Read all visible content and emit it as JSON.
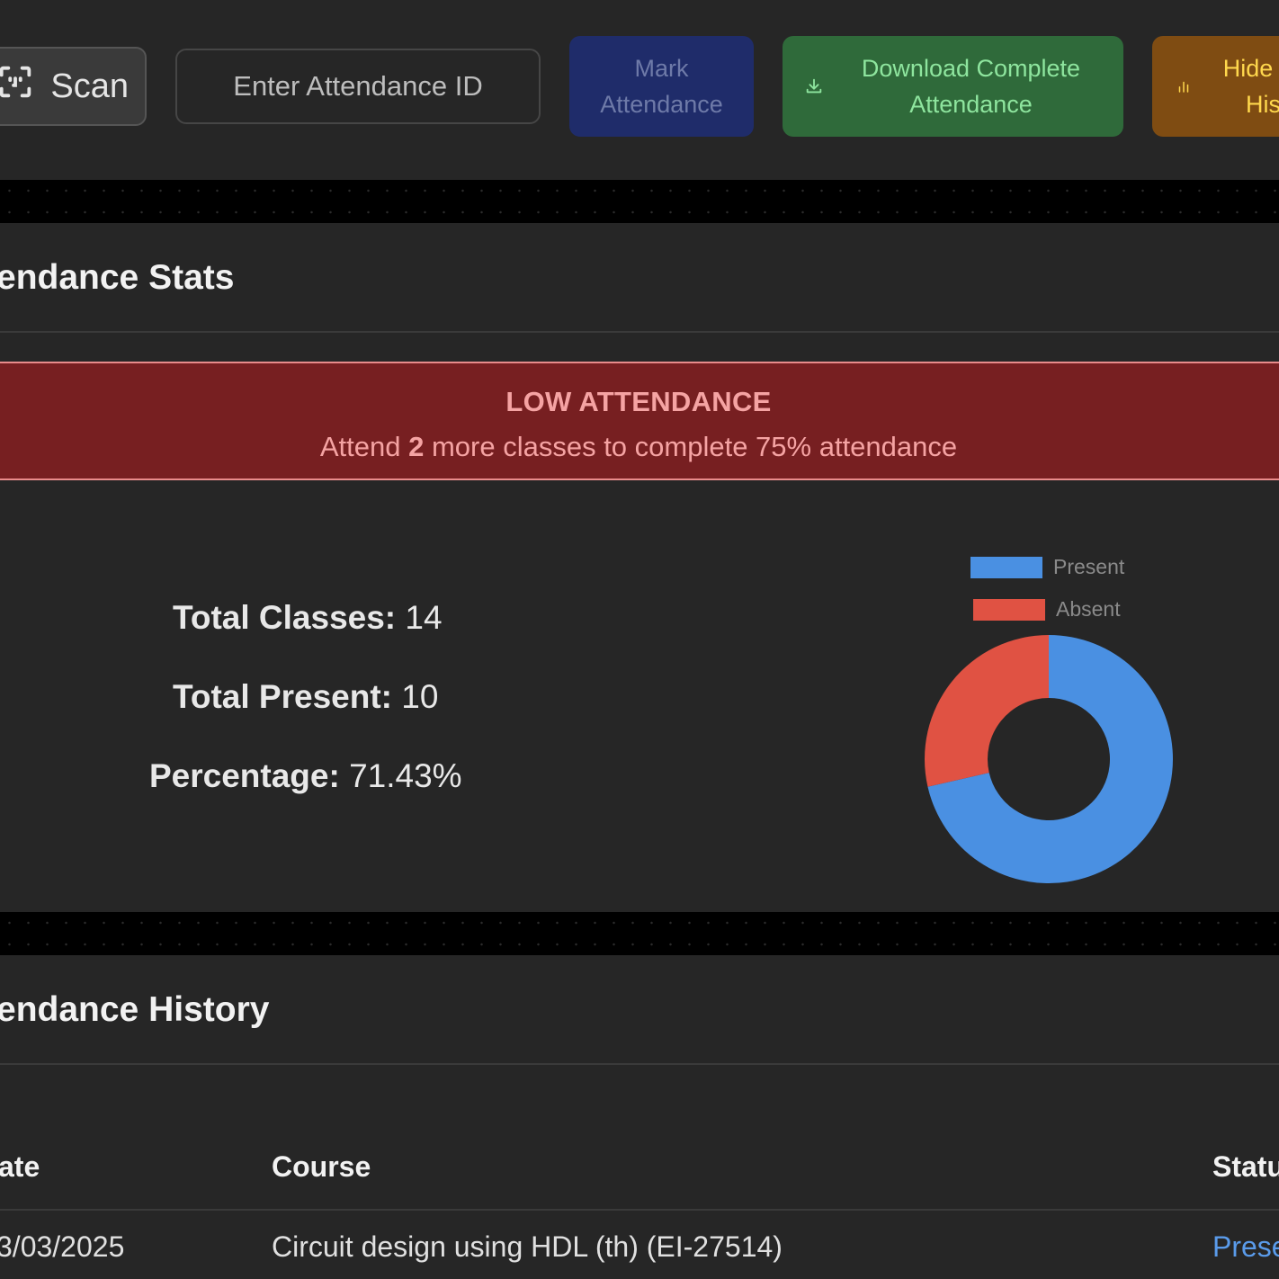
{
  "toolbar": {
    "scan_label": "Scan",
    "attendance_id_placeholder": "Enter Attendance ID",
    "mark_label_line1": "Mark",
    "mark_label_line2": "Attendance",
    "download_label_line1": "Download Complete",
    "download_label_line2": "Attendance",
    "hide_label_line1": "Hide",
    "hide_label_line2": "His"
  },
  "stats": {
    "title": "endance Stats",
    "alert": {
      "title": "LOW ATTENDANCE",
      "msg_before": "Attend ",
      "msg_count": "2",
      "msg_after": " more classes to complete 75% attendance"
    },
    "total_classes_label": "Total Classes:",
    "total_classes_value": "14",
    "total_present_label": "Total Present:",
    "total_present_value": "10",
    "percentage_label": "Percentage:",
    "percentage_value": "71.43%"
  },
  "chart_data": {
    "type": "pie",
    "subtype": "doughnut",
    "legend_position": "top",
    "categories": [
      "Present",
      "Absent"
    ],
    "values": [
      10,
      4
    ],
    "colors": [
      "#4a90e2",
      "#e05243"
    ]
  },
  "history": {
    "title": "endance History",
    "columns": [
      "ate",
      "Course",
      "Statu"
    ],
    "rows": [
      {
        "date": "3/03/2025",
        "course": "Circuit design using HDL (th) (EI-27514)",
        "status": "Prese"
      }
    ]
  },
  "colors": {
    "background": "#262626",
    "mark_button": "#1f2c6a",
    "download_button": "#2f6a3a",
    "hide_button": "#7f4c12",
    "alert_background": "#771f21",
    "present": "#4a90e2",
    "absent": "#e05243"
  }
}
